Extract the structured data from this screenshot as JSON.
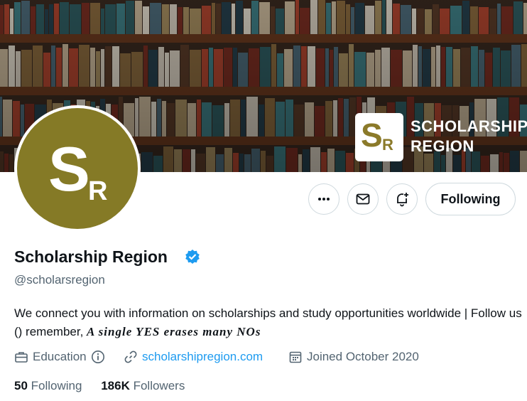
{
  "banner": {
    "logo_s": "S",
    "logo_r": "R",
    "brand_line1": "SCHOLARSHIP",
    "brand_line2": "REGION"
  },
  "avatar": {
    "s": "S",
    "r": "R",
    "bg_color": "#857a26"
  },
  "actions": {
    "more_icon": "ellipsis-icon",
    "message_icon": "mail-icon",
    "notify_icon": "bell-plus-icon",
    "follow_label": "Following"
  },
  "profile": {
    "name": "Scholarship Region",
    "handle": "@scholarsregion",
    "bio_text": "We connect you with information on scholarships and study opportunities worldwide | Follow us () remember, ",
    "bio_emphasis": "A single YES erases many NOs",
    "category": "Education",
    "website": "scholarshipregion.com",
    "joined": "Joined October 2020"
  },
  "stats": {
    "following_count": "50",
    "following_label": "Following",
    "followers_count": "186K",
    "followers_label": "Followers"
  },
  "colors": {
    "accent": "#1d9bf0",
    "secondary_text": "#536471",
    "verified": "#1d9bf0"
  }
}
